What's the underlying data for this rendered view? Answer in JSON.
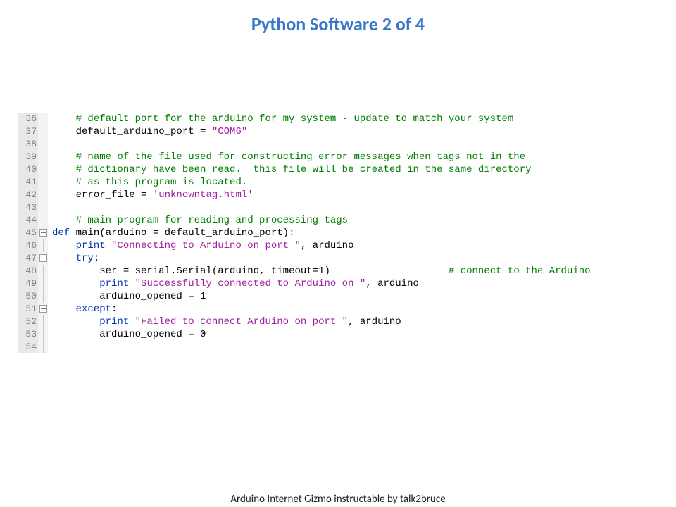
{
  "title": "Python Software 2 of 4",
  "footer": "Arduino Internet Gizmo instructable by talk2bruce",
  "lines": {
    "start": 36,
    "end": 54,
    "c36": "# default port for the arduino for my system - update to match your system",
    "c37a": "default_arduino_port = ",
    "c37b": "\"COM6\"",
    "c39": "# name of the file used for constructing error messages when tags not in the",
    "c40": "# dictionary have been read.  this file will be created in the same directory",
    "c41": "# as this program is located.",
    "c42a": "error_file = ",
    "c42b": "'unknowntag.html'",
    "c44": "# main program for reading and processing tags",
    "c45_def": "def",
    "c45_sig": " main(arduino = default_arduino_port):",
    "c46_kw": "print",
    "c46_str": " \"Connecting to Arduino on port \"",
    "c46_rest": ", arduino",
    "c47_kw": "try",
    "c48a": "ser = serial.Serial(arduino, timeout=",
    "c48n": "1",
    "c48b": ")",
    "c48c": "                    ",
    "c48cm": "# connect to the Arduino",
    "c49_kw": "print",
    "c49_str": " \"Successfully connected to Arduino on \"",
    "c49_rest": ", arduino",
    "c50a": "arduino_opened = ",
    "c50n": "1",
    "c51_kw": "except",
    "c52_kw": "print",
    "c52_str": " \"Failed to connect Arduino on port \"",
    "c52_rest": ", arduino",
    "c53a": "arduino_opened = ",
    "c53n": "0"
  }
}
